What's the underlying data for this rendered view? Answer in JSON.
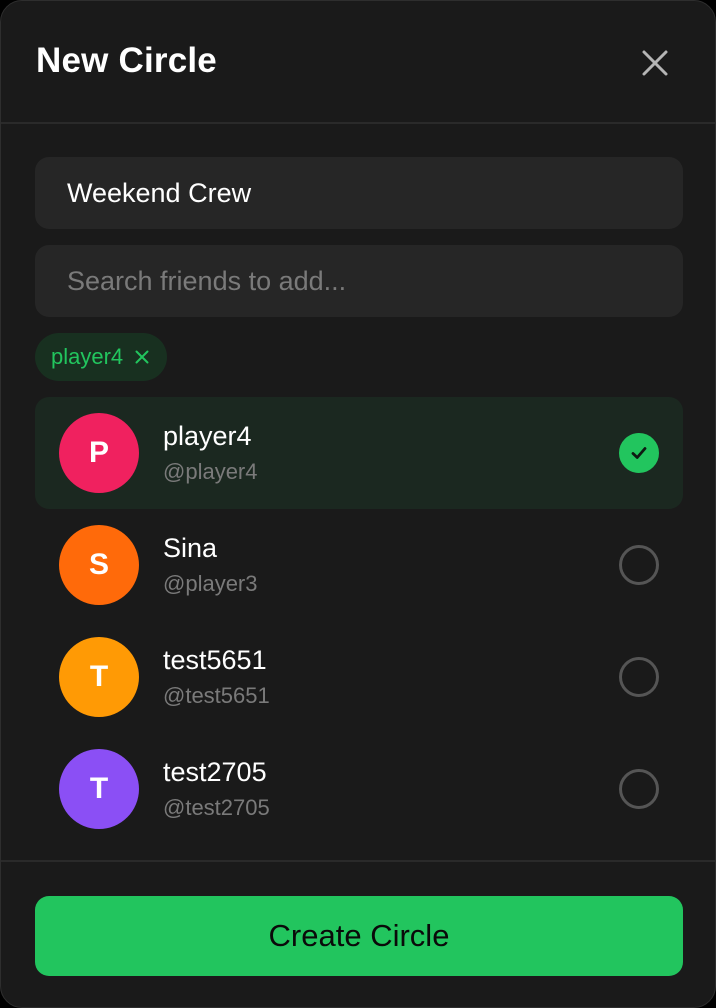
{
  "modal": {
    "title": "New Circle",
    "circle_name_value": "Weekend Crew",
    "search_placeholder": "Search friends to add...",
    "create_label": "Create Circle"
  },
  "icons": {
    "close": "close-icon",
    "chip_remove": "close-icon",
    "check": "check-icon"
  },
  "colors": {
    "accent": "#22c55e",
    "background": "#1a1a1a",
    "field": "#262626",
    "selected_row": "#1b2820"
  },
  "selected_chips": [
    {
      "label": "player4"
    }
  ],
  "friends": [
    {
      "initial": "P",
      "name": "player4",
      "handle": "@player4",
      "color": "#f0215f",
      "selected": true
    },
    {
      "initial": "S",
      "name": "Sina",
      "handle": "@player3",
      "color": "#ff6a0a",
      "selected": false
    },
    {
      "initial": "T",
      "name": "test5651",
      "handle": "@test5651",
      "color": "#ff9a05",
      "selected": false
    },
    {
      "initial": "T",
      "name": "test2705",
      "handle": "@test2705",
      "color": "#8b4ff5",
      "selected": false
    }
  ]
}
